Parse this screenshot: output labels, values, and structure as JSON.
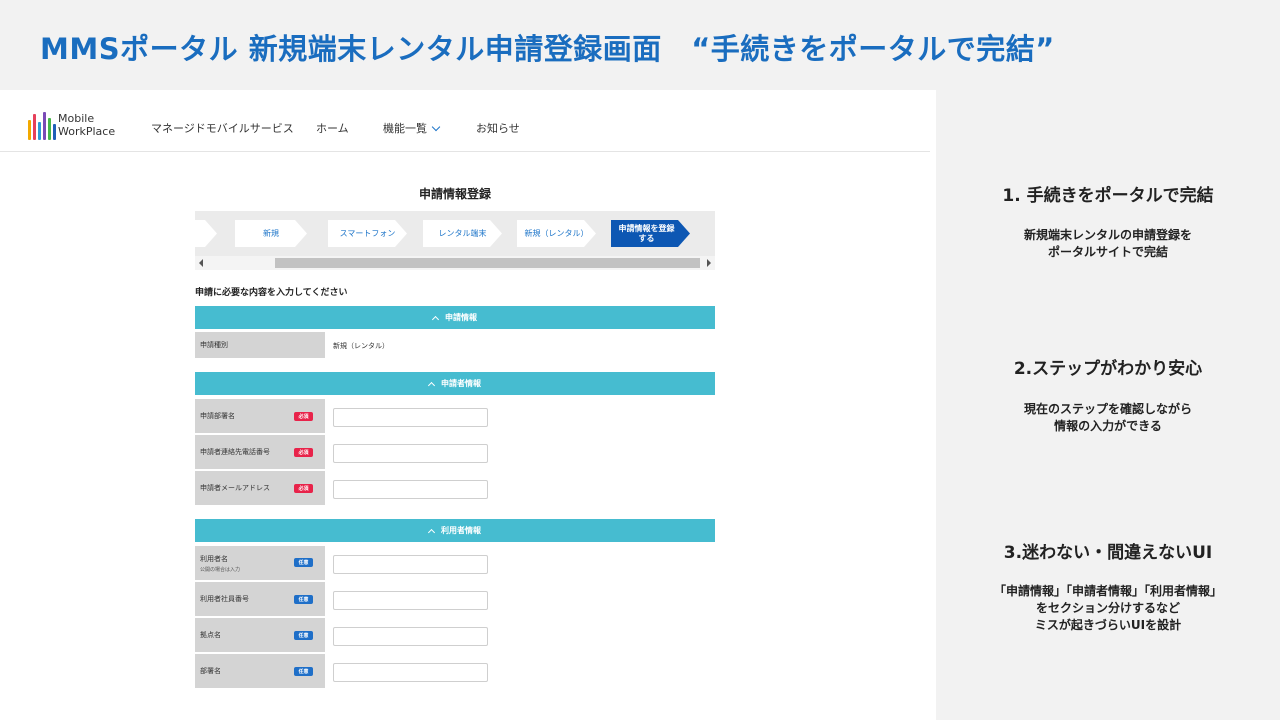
{
  "slide": {
    "title": "MMSポータル 新規端末レンタル申請登録画面　“手続きをポータルで完結”"
  },
  "header": {
    "logo_line1": "Mobile",
    "logo_line2": "WorkPlace",
    "nav": [
      "マネージドモバイルサービス",
      "ホーム",
      "機能一覧",
      "お知らせ"
    ]
  },
  "form": {
    "title": "申請情報登録",
    "steps": [
      "新規",
      "スマートフォン",
      "レンタル端末",
      "新規（レンタル）",
      "申請情報を登録する"
    ],
    "instruction": "申請に必要な内容を入力してください",
    "sections": {
      "application": {
        "title": "申請情報",
        "type_label": "申請種別",
        "type_value": "新規（レンタル）"
      },
      "applicant": {
        "title": "申請者情報",
        "fields": [
          {
            "label": "申請部署名",
            "badge": "必須"
          },
          {
            "label": "申請者連絡先電話番号",
            "badge": "必須"
          },
          {
            "label": "申請者メールアドレス",
            "badge": "必須"
          }
        ]
      },
      "user": {
        "title": "利用者情報",
        "fields": [
          {
            "label": "利用者名",
            "note": "公開の場合は入力",
            "badge": "任意"
          },
          {
            "label": "利用者社員番号",
            "badge": "任意"
          },
          {
            "label": "拠点名",
            "badge": "任意"
          },
          {
            "label": "部署名",
            "badge": "任意"
          }
        ]
      }
    }
  },
  "points": [
    {
      "title": "1. 手続きをポータルで完結",
      "line1": "新規端末レンタルの申請登録を",
      "line2": "ポータルサイトで完結"
    },
    {
      "title": "2.ステップがわかり安心",
      "line1": "現在のステップを確認しながら",
      "line2": "情報の入力ができる"
    },
    {
      "title": "3.迷わない・間違えないUI",
      "line1": "「申請情報」「申請者情報」「利用者情報」",
      "line2": "をセクション分けするなど",
      "line3": "ミスが起きづらいUIを設計"
    }
  ],
  "colors": {
    "title_blue": "#1a6dbf",
    "section_teal": "#46bcd0",
    "step_active": "#0d57b3",
    "required_red": "#e8234a",
    "optional_blue": "#1f6fc8"
  }
}
